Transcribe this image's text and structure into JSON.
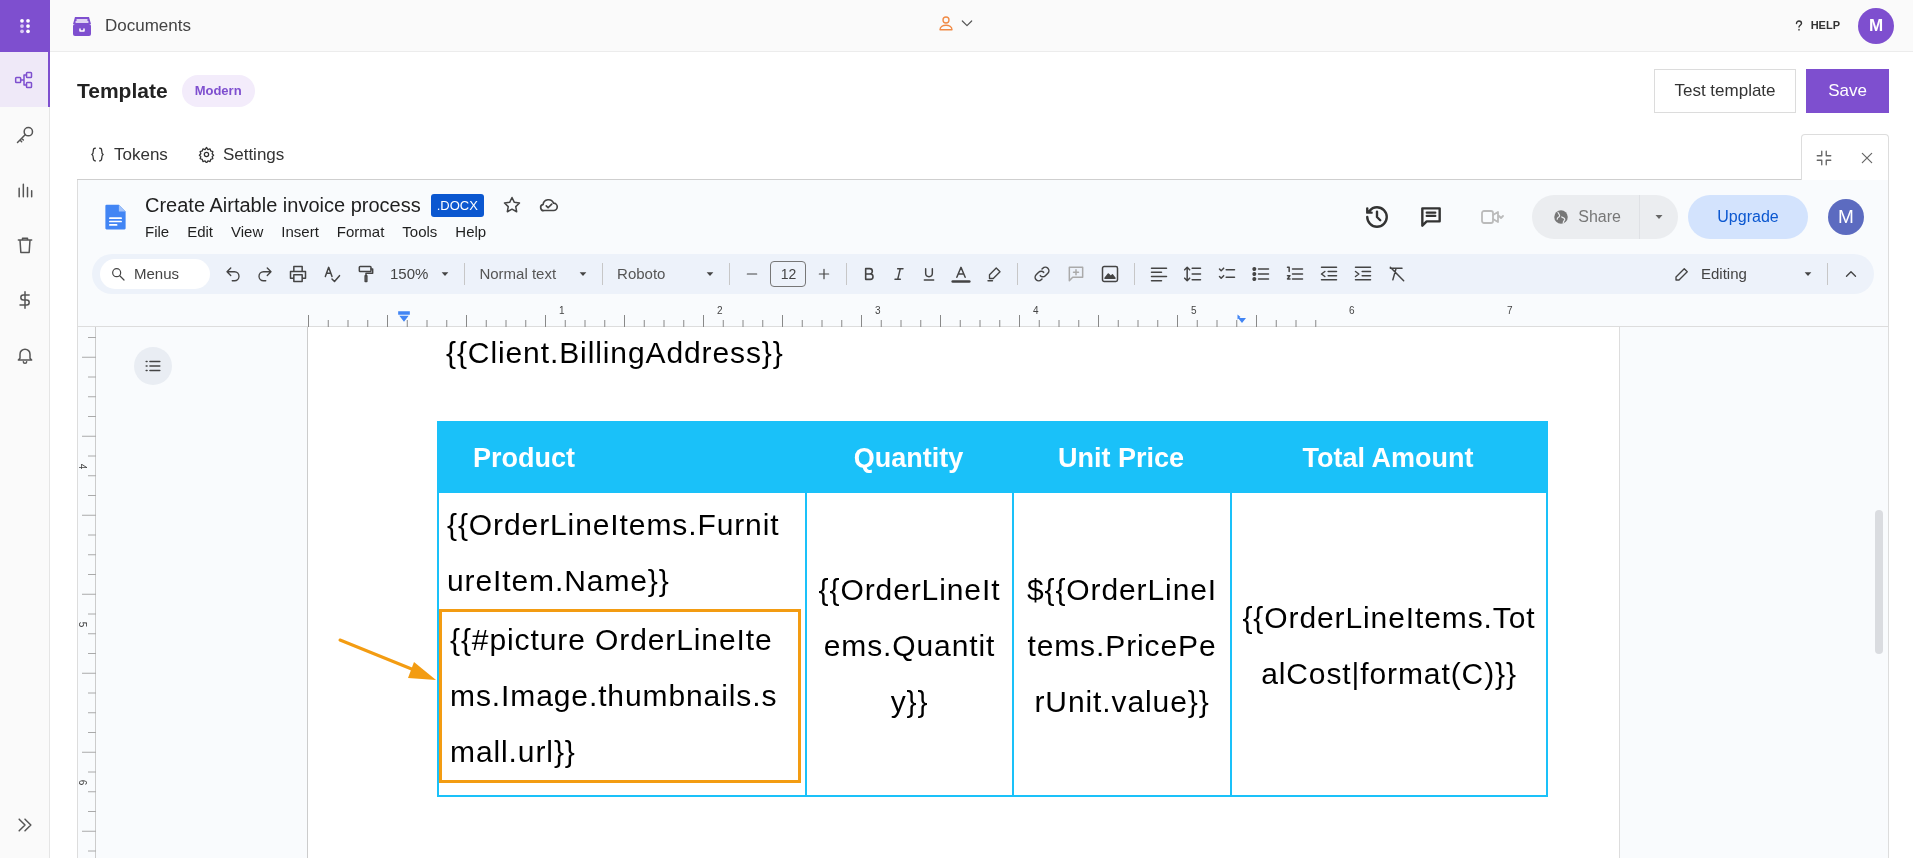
{
  "app": {
    "section": "Documents",
    "help": "HELP",
    "avatar": "M"
  },
  "rail": [
    {
      "kind": "flow",
      "selected": true
    },
    {
      "kind": "key",
      "selected": false
    },
    {
      "kind": "chart",
      "selected": false
    },
    {
      "kind": "trash",
      "selected": false
    },
    {
      "kind": "dollar",
      "selected": false
    },
    {
      "kind": "bell",
      "selected": false
    }
  ],
  "template": {
    "title": "Template",
    "badge": "Modern",
    "buttons": [
      {
        "label": "Test template",
        "kind": "secondary"
      },
      {
        "label": "Save",
        "kind": "primary"
      }
    ]
  },
  "tabs": [
    {
      "label": "Tokens",
      "kind": "braces"
    },
    {
      "label": "Settings",
      "kind": "gear"
    }
  ],
  "doc": {
    "title": "Create Airtable invoice process",
    "badge": ".DOCX",
    "menus": [
      "File",
      "Edit",
      "View",
      "Insert",
      "Format",
      "Tools",
      "Help"
    ],
    "share": "Share",
    "upgrade": "Upgrade",
    "avatar": "M",
    "toolbar": {
      "search": "Menus",
      "zoom": "150%",
      "style": "Normal text",
      "font": "Roboto",
      "size": "12",
      "mode": "Editing"
    },
    "ruler": {
      "horizontal": [
        "1",
        "2",
        "3",
        "4",
        "5",
        "6",
        "7"
      ],
      "vertical": [
        "4",
        "5",
        "6"
      ]
    }
  },
  "page": {
    "client": "{{Client.BillingAddress}}",
    "table": {
      "columns": [
        "Product",
        "Quantity",
        "Unit Price",
        "Total Amount"
      ],
      "rows": [
        [
          {
            "parts": [
              {
                "text": "{{OrderLineItems.FurnitureItem.Name}}",
                "highlighted": false
              },
              {
                "text": "{{#picture OrderLineItems.Image.thumbnails.small.url}}",
                "highlighted": true
              }
            ]
          },
          {
            "parts": [
              {
                "text": "{{OrderLineItems.Quantity}}",
                "highlighted": false
              }
            ]
          },
          {
            "parts": [
              {
                "text": "${{OrderLineItems.PricePerUnit.value}}",
                "highlighted": false
              }
            ]
          },
          {
            "parts": [
              {
                "text": "{{OrderLineItems.TotalCost|format(C)}}",
                "highlighted": false
              }
            ]
          }
        ]
      ]
    }
  }
}
